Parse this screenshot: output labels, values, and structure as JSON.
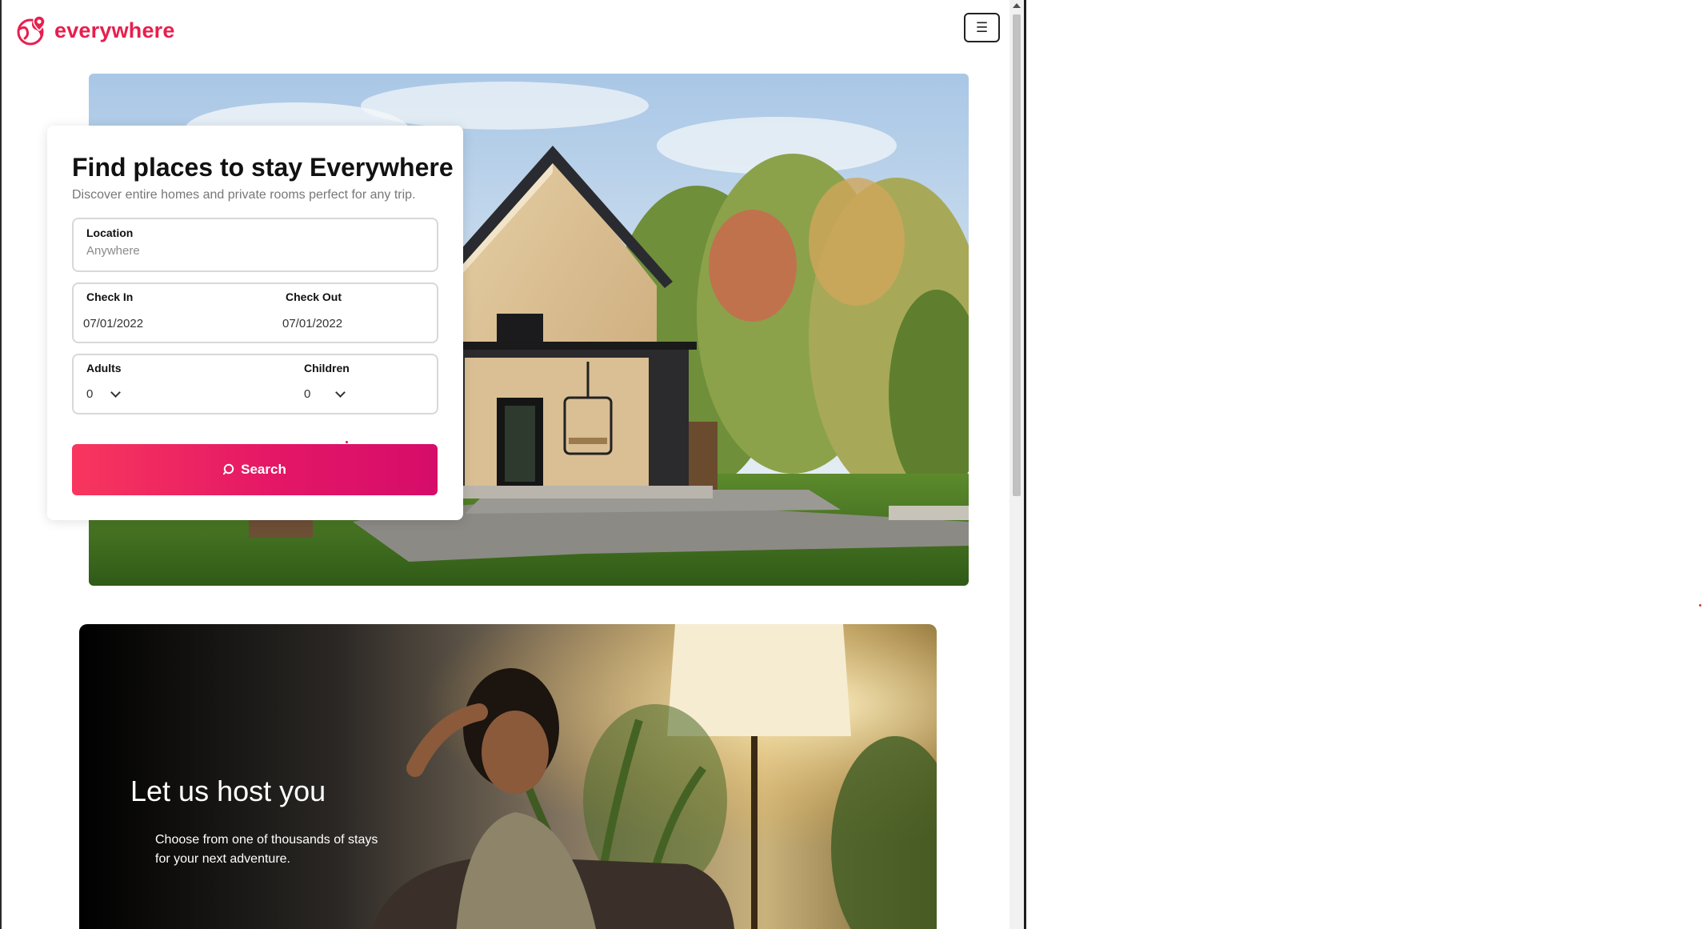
{
  "header": {
    "brand_name": "everywhere",
    "brand_color": "#e81e4d",
    "logo_icon": "globe-pin-icon",
    "menu_icon": "hamburger-menu-icon",
    "menu_glyph": "☰"
  },
  "hero": {
    "image": "wooden-a-frame-cabin-in-forest"
  },
  "search_card": {
    "title": "Find places to stay Everywhere",
    "subtitle": "Discover entire homes and private rooms perfect for any trip.",
    "location": {
      "label": "Location",
      "placeholder": "Anywhere"
    },
    "check_in": {
      "label": "Check In",
      "value": "07/01/2022"
    },
    "check_out": {
      "label": "Check Out",
      "value": "07/01/2022"
    },
    "adults": {
      "label": "Adults",
      "value": "0"
    },
    "children": {
      "label": "Children",
      "value": "0"
    },
    "search_button": {
      "label": "Search",
      "icon": "search-icon"
    },
    "button_gradient": [
      "#f8365e",
      "#d60c6a"
    ]
  },
  "host_section": {
    "title": "Let us host you",
    "text": "Choose from one of thousands of stays for your next adventure.",
    "image": "smiling-woman-on-sofa-with-lamp"
  }
}
